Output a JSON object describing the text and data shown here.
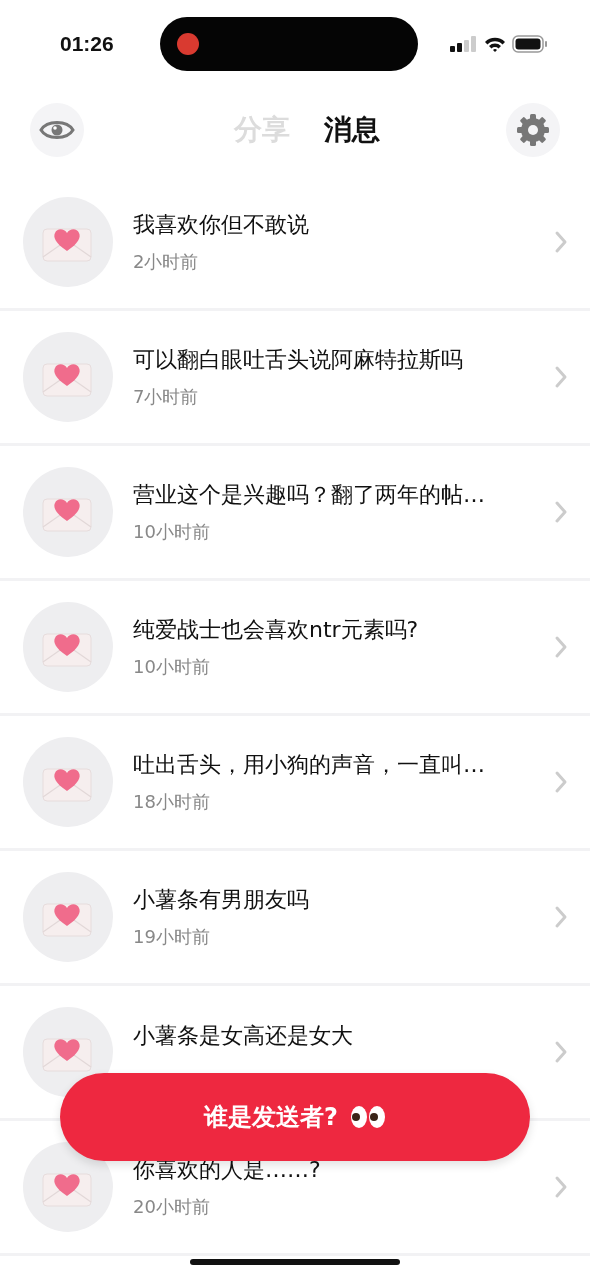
{
  "status_bar": {
    "time": "01:26"
  },
  "tabs": [
    {
      "label": "分享",
      "selected": false
    },
    {
      "label": "消息",
      "selected": true
    }
  ],
  "messages": [
    {
      "title": "我喜欢你但不敢说",
      "time": "2小时前"
    },
    {
      "title": "可以翻白眼吐舌头说阿麻特拉斯吗",
      "time": "7小时前"
    },
    {
      "title": "营业这个是兴趣吗？翻了两年的帖…",
      "time": "10小时前"
    },
    {
      "title": "纯爱战士也会喜欢ntr元素吗?",
      "time": "10小时前"
    },
    {
      "title": "吐出舌头，用小狗的声音，一直叫…",
      "time": "18小时前"
    },
    {
      "title": "小薯条有男朋友吗",
      "time": "19小时前"
    },
    {
      "title": "小薯条是女高还是女大"
    },
    {
      "title": "你喜欢的人是……?",
      "time": "20小时前"
    }
  ],
  "sender_button": {
    "label": "谁是发送者?"
  }
}
